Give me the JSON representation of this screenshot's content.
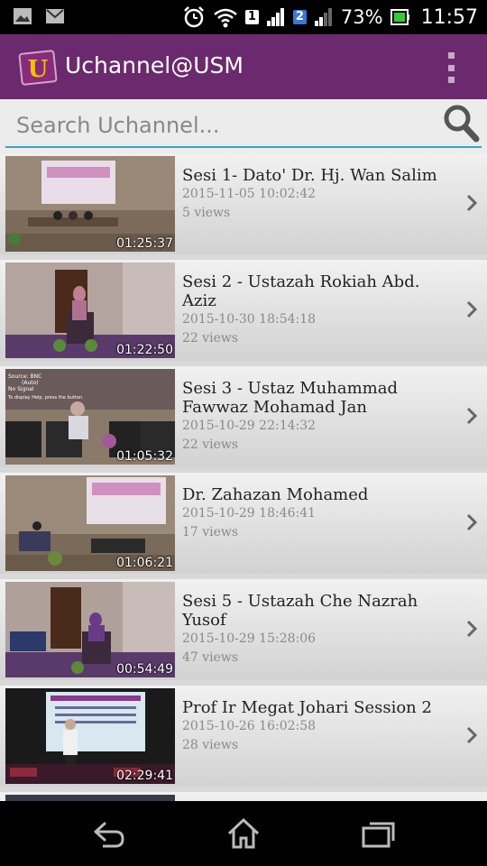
{
  "status_bar": {
    "left_icons": [
      "image-icon",
      "mail-icon"
    ],
    "sim1": "1",
    "sim2": "2",
    "battery": "73%",
    "time": "11:57"
  },
  "app_bar": {
    "logo_letter": "U",
    "title": "Uchannel@USM",
    "overflow_icon": "overflow-menu-icon"
  },
  "search": {
    "placeholder": "Search Uchannel...",
    "icon": "search-icon"
  },
  "videos": [
    {
      "title": "Sesi 1- Dato' Dr. Hj. Wan Salim",
      "date": "2015-11-05 10:02:42",
      "views": "5 views",
      "duration": "01:25:37"
    },
    {
      "title": "Sesi 2 - Ustazah Rokiah Abd. Aziz",
      "date": "2015-10-30 18:54:18",
      "views": "22 views",
      "duration": "01:22:50"
    },
    {
      "title": "Sesi 3 - Ustaz Muhammad Fawwaz Mohamad Jan",
      "date": "2015-10-29 22:14:32",
      "views": "22 views",
      "duration": "01:05:32",
      "overlay_text": [
        "Source: BNC",
        "(Auto)",
        "No Signal",
        "To display Help, press the button"
      ]
    },
    {
      "title": "Dr. Zahazan Mohamed",
      "date": "2015-10-29 18:46:41",
      "views": "17 views",
      "duration": "01:06:21"
    },
    {
      "title": "Sesi 5 - Ustazah Che Nazrah Yusof",
      "date": "2015-10-29 15:28:06",
      "views": "47 views",
      "duration": "00:54:49"
    },
    {
      "title": "Prof Ir Megat Johari Session 2",
      "date": "2015-10-26 16:02:58",
      "views": "28 views",
      "duration": "02:29:41"
    }
  ],
  "nav_bar": {
    "icons": [
      "back-icon",
      "home-icon",
      "recent-apps-icon"
    ]
  },
  "colors": {
    "app_bar": "#6b2a6d",
    "search_underline": "#33a6cc"
  }
}
